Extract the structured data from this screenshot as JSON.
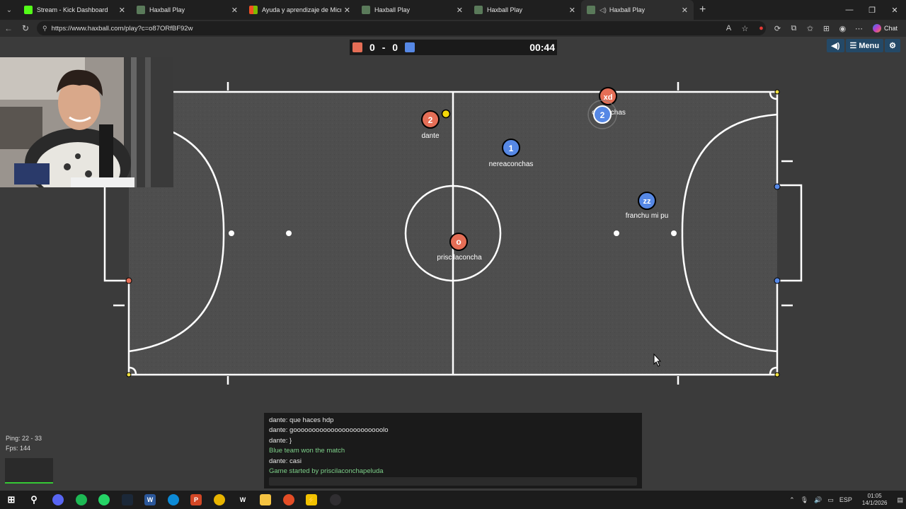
{
  "tabs": [
    {
      "title": "Stream - Kick Dashboard",
      "favicon_color": "#53fc18"
    },
    {
      "title": "Haxball Play",
      "favicon_color": "#5a7a5a"
    },
    {
      "title": "Ayuda y aprendizaje de Microsoft",
      "favicon_color": "#f25022"
    },
    {
      "title": "Haxball Play",
      "favicon_color": "#5a7a5a"
    },
    {
      "title": "Haxball Play",
      "favicon_color": "#5a7a5a"
    },
    {
      "title": "Haxball Play",
      "favicon_color": "#5a7a5a"
    }
  ],
  "address": {
    "url": "https://www.haxball.com/play?c=o87ORfBF92w"
  },
  "browser": {
    "chat_label": "Chat"
  },
  "scoreboard": {
    "red_score": "0",
    "separator": "-",
    "blue_score": "0",
    "time": "00:44",
    "red_color": "#e56e56",
    "blue_color": "#5688e5"
  },
  "game_menu": {
    "menu_label": "Menu"
  },
  "players": [
    {
      "avatar": "2",
      "name": "dante",
      "team": "red"
    },
    {
      "avatar": "1",
      "name": "nereaconchas",
      "team": "blue"
    },
    {
      "avatar": "xd",
      "name": "",
      "team": "red"
    },
    {
      "avatar": "2",
      "name": "chconchas",
      "team": "blue"
    },
    {
      "avatar": "zz",
      "name": "franchu mi pu",
      "team": "blue"
    },
    {
      "avatar": "o",
      "name": "priscilaconcha",
      "team": "red"
    }
  ],
  "stats": {
    "ping": "Ping: 22 - 33",
    "fps": "Fps: 144"
  },
  "chat": [
    {
      "text": "dante: que haces hdp",
      "system": false
    },
    {
      "text": "dante: goooooooooooooooooooooooolo",
      "system": false
    },
    {
      "text": "dante: }",
      "system": false
    },
    {
      "text": "Blue team won the match",
      "system": true
    },
    {
      "text": "dante: casi",
      "system": false
    },
    {
      "text": "Game started by priscilaconchapeluda",
      "system": true
    }
  ],
  "taskbar": {
    "lang": "ESP",
    "time": "01:05",
    "date": "14/1/2026"
  }
}
